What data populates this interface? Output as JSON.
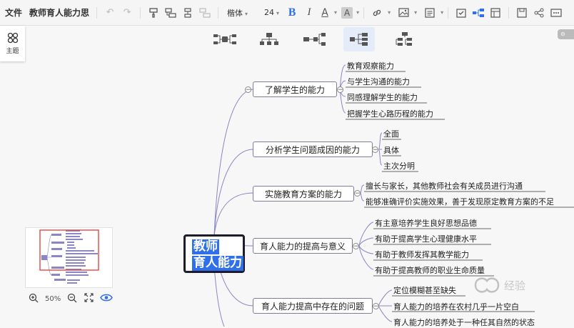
{
  "toolbar": {
    "file_label": "文件",
    "doc_title": "教师育人能力思",
    "font_name": "楷体",
    "font_size": "24",
    "bold_label": "B",
    "italic_label": "I",
    "text_color_label": "A",
    "highlight_label": "A"
  },
  "theme_panel": {
    "label": "主题"
  },
  "zoom": {
    "value": "50%"
  },
  "mindmap": {
    "root": {
      "line1": "教师",
      "line2": "育人能力"
    },
    "branches": [
      {
        "label": "了解学生的能力",
        "children": [
          "教育观察能力",
          "与学生沟通的能力",
          "同感理解学生的能力",
          "把握学生心路历程的能力"
        ]
      },
      {
        "label": "分析学生问题成因的能力",
        "children": [
          "全面",
          "具体",
          "主次分明"
        ]
      },
      {
        "label": "实施教育方案的能力",
        "children": [
          "擅长与家长，其他教师社会有关成员进行沟通",
          "能够准确评价实施效果，善于发现原定教育方案的不足"
        ]
      },
      {
        "label": "育人能力的提高与意义",
        "children": [
          "有主意培养学生良好思想品德",
          "有助于提高学生心理健康水平",
          "有助于教师发挥其教学能力",
          "有助于提高教师的职业生命质量"
        ]
      },
      {
        "label": "育人能力提高中存在的问题",
        "children": [
          "定位模糊甚至缺失",
          "育人能力的培养在农村几乎一片空白",
          "育人能力的培养处于一种任其自然的状态"
        ]
      }
    ]
  },
  "watermark": {
    "text": "经验"
  },
  "colors": {
    "accent": "#2f6fea",
    "branch_line": "#8b86c5",
    "minimap_frame": "#e53935"
  }
}
